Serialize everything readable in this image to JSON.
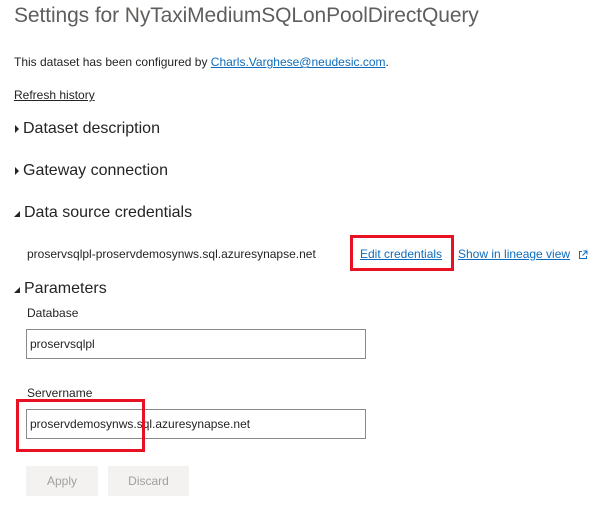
{
  "header": {
    "title": "Settings for NyTaxiMediumSQLonPoolDirectQuery"
  },
  "configured": {
    "prefix": "This dataset has been configured by ",
    "user": "Charls.Varghese@neudesic.com",
    "suffix": "."
  },
  "refresh_history": "Refresh history",
  "sections": {
    "dataset_description": "Dataset description",
    "gateway_connection": "Gateway connection",
    "data_source_credentials": "Data source credentials",
    "parameters": "Parameters"
  },
  "data_source": {
    "name": "proservsqlpl-proservdemosynws.sql.azuresynapse.net",
    "edit_credentials": "Edit credentials",
    "lineage_view": "Show in lineage view"
  },
  "parameters": {
    "database_label": "Database",
    "database_value": "proservsqlpl",
    "servername_label": "Servername",
    "servername_value": "proservdemosynws.sql.azuresynapse.net"
  },
  "buttons": {
    "apply": "Apply",
    "discard": "Discard"
  },
  "colors": {
    "link": "#0f6cbd",
    "highlight": "#e81123",
    "title": "#605e5c",
    "disabled_text": "#a19f9d",
    "button_bg": "#f3f2f1"
  },
  "icons": {
    "collapsed_section": "caret-right-icon",
    "expanded_section": "caret-down-icon",
    "external_link": "external-link-icon"
  }
}
